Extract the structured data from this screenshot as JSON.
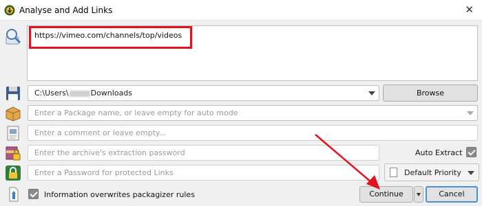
{
  "window": {
    "title": "Analyse and Add Links",
    "close_glyph": "✕"
  },
  "links": {
    "text": "https://vimeo.com/channels/top/videos"
  },
  "save_to": {
    "path_prefix": "C:\\Users\\",
    "path_suffix": "Downloads",
    "browse_label": "Browse"
  },
  "package": {
    "placeholder": "Enter a Package name, or leave empty for auto mode"
  },
  "comment": {
    "placeholder": "Enter a comment or leave empty..."
  },
  "archive": {
    "placeholder": "Enter the archive's extraction password",
    "auto_extract_label": "Auto Extract",
    "auto_extract_checked": true
  },
  "download_password": {
    "placeholder": "Enter a Password for protected Links",
    "priority_label": "Default Priority"
  },
  "footer": {
    "overwrite_label": "Information overwrites packagizer rules",
    "overwrite_checked": true,
    "continue_label": "Continue",
    "cancel_label": "Cancel"
  },
  "icons": {
    "app": "jdownloader-icon",
    "analyse": "magnifier-icon",
    "save": "floppy-disk-icon",
    "package": "package-box-icon",
    "comment": "comment-note-icon",
    "archive": "archive-lock-icon",
    "password": "padlock-icon",
    "overwrite": "packagizer-icon"
  },
  "colors": {
    "highlight": "#e0141e",
    "arrow": "#e0141e",
    "cancel_border": "#4a8fd4"
  }
}
